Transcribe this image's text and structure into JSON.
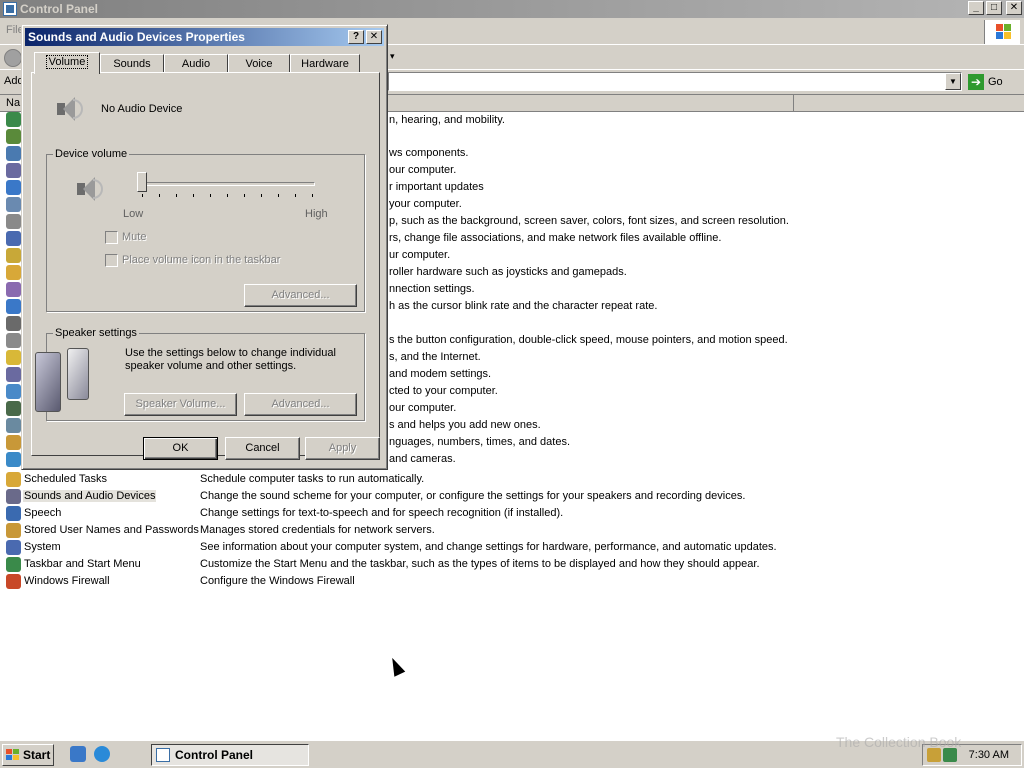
{
  "window": {
    "title": "Control Panel",
    "minimize": "_",
    "maximize": "□",
    "close": "✕"
  },
  "menubar": {
    "file_partial": "File"
  },
  "addressbar": {
    "label": "Add",
    "go_label": "Go"
  },
  "list_header": {
    "name": "Na"
  },
  "partial_comments": [
    "n, hearing, and mobility.",
    "ws components.",
    "our computer.",
    "r important updates",
    "your computer.",
    "p, such as the background, screen saver, colors, font sizes, and screen resolution.",
    "rs, change file associations, and make network files available offline.",
    "ur computer.",
    "roller hardware such as joysticks and gamepads.",
    "nnection settings.",
    "h as the cursor blink rate and the character repeat rate.",
    "s the button configuration, double-click speed, mouse pointers, and motion speed.",
    "s, and the Internet.",
    "and modem settings.",
    "cted to your computer.",
    "our computer.",
    "s and helps you add new ones.",
    "nguages, numbers, times, and dates.",
    "and cameras."
  ],
  "items": [
    {
      "name": "Scheduled Tasks",
      "comment": "Schedule computer tasks to run automatically.",
      "color": "#d8a838"
    },
    {
      "name": "Sounds and Audio Devices",
      "comment": "Change the sound scheme for your computer, or configure the settings for your speakers and recording devices.",
      "color": "#6a6a8a"
    },
    {
      "name": "Speech",
      "comment": "Change settings for text-to-speech and for speech recognition (if installed).",
      "color": "#3a6ab0"
    },
    {
      "name": "Stored User Names and Passwords",
      "comment": "Manages stored credentials for network servers.",
      "color": "#c89838"
    },
    {
      "name": "System",
      "comment": "See information about your computer system, and change settings for hardware, performance, and automatic updates.",
      "color": "#4a6ab0"
    },
    {
      "name": "Taskbar and Start Menu",
      "comment": "Customize the Start Menu and the taskbar, such as the types of items to be displayed and how they should appear.",
      "color": "#3a8a4a"
    },
    {
      "name": "Windows Firewall",
      "comment": "Configure the Windows Firewall",
      "color": "#c84828"
    }
  ],
  "selected_item": "Sounds and Audio Devices",
  "dialog": {
    "title": "Sounds and Audio Devices Properties",
    "help": "?",
    "close": "✕",
    "tabs": [
      {
        "label": "Volume",
        "active": true
      },
      {
        "label": "Sounds",
        "active": false
      },
      {
        "label": "Audio",
        "active": false
      },
      {
        "label": "Voice",
        "active": false
      },
      {
        "label": "Hardware",
        "active": false
      }
    ],
    "device_name": "No Audio Device",
    "device_volume": {
      "legend": "Device volume",
      "low_label": "Low",
      "high_label": "High",
      "level": 0,
      "mute_label": "Mute",
      "mute_checked": false,
      "taskbar_label": "Place volume icon in the taskbar",
      "taskbar_checked": false,
      "advanced": "Advanced..."
    },
    "speaker_settings": {
      "legend": "Speaker settings",
      "description": "Use the settings below to change individual speaker volume and other settings.",
      "speaker_volume": "Speaker Volume...",
      "advanced": "Advanced..."
    },
    "ok": "OK",
    "cancel": "Cancel",
    "apply": "Apply"
  },
  "taskbar": {
    "start": "Start",
    "task_control_panel": "Control Panel",
    "clock": "7:30 AM"
  },
  "watermark": "The Collection Book"
}
